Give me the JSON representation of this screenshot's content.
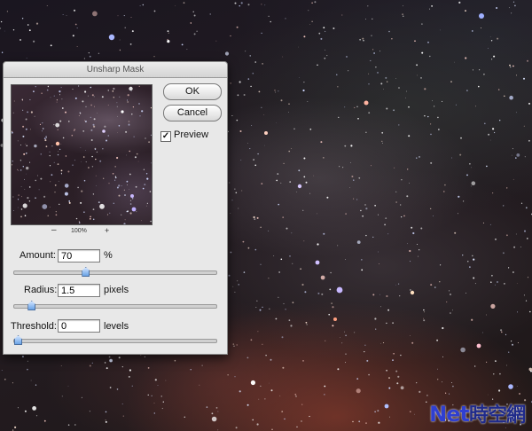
{
  "dialog": {
    "title": "Unsharp Mask",
    "ok_label": "OK",
    "cancel_label": "Cancel",
    "preview_label": "Preview",
    "preview_checked": true,
    "check_mark": "✓",
    "zoom": {
      "minus": "–",
      "value": "100%",
      "plus": "+"
    },
    "amount": {
      "label": "Amount:",
      "value": "70",
      "unit": "%",
      "slider_fraction": 0.35
    },
    "radius": {
      "label": "Radius:",
      "value": "1.5",
      "unit": "pixels",
      "slider_fraction": 0.07
    },
    "threshold": {
      "label": "Threshold:",
      "value": "0",
      "unit": "levels",
      "slider_fraction": 0.0
    }
  },
  "watermark": {
    "text_a": "Net",
    "text_b": "時空網"
  },
  "colors": {
    "slider_thumb": "#6aa3e6",
    "watermark": "#2f3fd0"
  }
}
